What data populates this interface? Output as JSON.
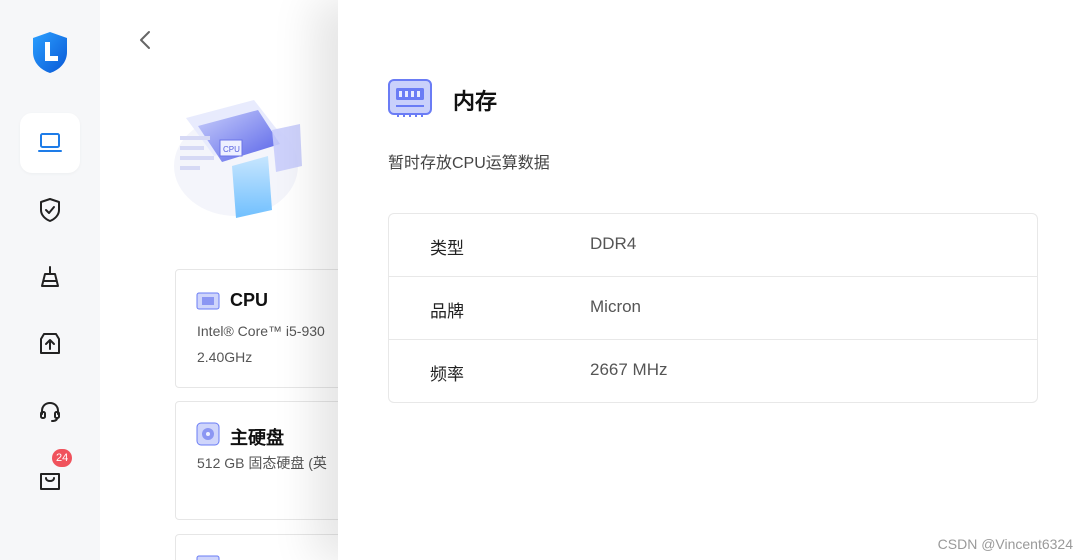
{
  "sidebar": {
    "items": [
      {
        "name": "laptop-icon",
        "active": true
      },
      {
        "name": "shield-check-icon",
        "active": false
      },
      {
        "name": "clean-icon",
        "active": false
      },
      {
        "name": "drive-upload-icon",
        "active": false
      },
      {
        "name": "headset-icon",
        "active": false
      },
      {
        "name": "shopping-bag-icon",
        "active": false,
        "badge": "24"
      }
    ]
  },
  "background": {
    "cards": [
      {
        "title": "CPU",
        "icon": "cpu-icon",
        "lines": [
          "Intel® Core™ i5-930",
          "2.40GHz"
        ]
      },
      {
        "title": "主硬盘",
        "icon": "disk-icon",
        "lines": [
          "512 GB 固态硬盘 (英"
        ]
      },
      {
        "title": "",
        "icon": "memory-icon",
        "lines": []
      }
    ]
  },
  "panel": {
    "title": "内存",
    "icon": "memory-chip-icon",
    "description": "暂时存放CPU运算数据",
    "specs": [
      {
        "key": "类型",
        "value": "DDR4"
      },
      {
        "key": "品牌",
        "value": "Micron"
      },
      {
        "key": "频率",
        "value": "2667 MHz"
      }
    ]
  },
  "watermark": "CSDN @Vincent6324",
  "colors": {
    "brand": "#1e7ce8",
    "accent": "#6a7cf5",
    "badge": "#f0525c"
  }
}
